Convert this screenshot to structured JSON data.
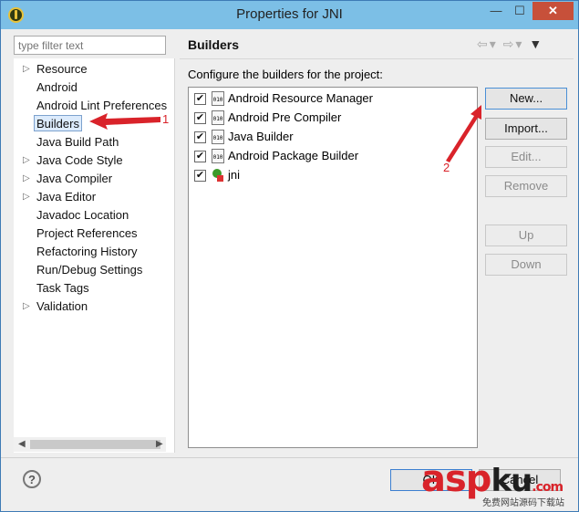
{
  "window": {
    "title": "Properties for JNI",
    "min_label": "—",
    "max_label": "☐",
    "close_label": "✕"
  },
  "filter": {
    "placeholder": "type filter text"
  },
  "tree": {
    "items": [
      {
        "label": "Resource",
        "expandable": true
      },
      {
        "label": "Android",
        "expandable": false
      },
      {
        "label": "Android Lint Preferences",
        "expandable": false
      },
      {
        "label": "Builders",
        "expandable": false,
        "selected": true
      },
      {
        "label": "Java Build Path",
        "expandable": false
      },
      {
        "label": "Java Code Style",
        "expandable": true
      },
      {
        "label": "Java Compiler",
        "expandable": true
      },
      {
        "label": "Java Editor",
        "expandable": true
      },
      {
        "label": "Javadoc Location",
        "expandable": false
      },
      {
        "label": "Project References",
        "expandable": false
      },
      {
        "label": "Refactoring History",
        "expandable": false
      },
      {
        "label": "Run/Debug Settings",
        "expandable": false
      },
      {
        "label": "Task Tags",
        "expandable": false
      },
      {
        "label": "Validation",
        "expandable": true
      }
    ]
  },
  "page": {
    "title": "Builders",
    "config_label": "Configure the builders for the project:"
  },
  "builders": [
    {
      "label": "Android Resource Manager",
      "checked": true,
      "icon": "builder-010-icon"
    },
    {
      "label": "Android Pre Compiler",
      "checked": true,
      "icon": "builder-010-icon"
    },
    {
      "label": "Java Builder",
      "checked": true,
      "icon": "builder-010-icon"
    },
    {
      "label": "Android Package Builder",
      "checked": true,
      "icon": "builder-010-icon"
    },
    {
      "label": "jni",
      "checked": true,
      "icon": "external-tool-icon"
    }
  ],
  "buttons": {
    "new": "New...",
    "import": "Import...",
    "edit": "Edit...",
    "remove": "Remove",
    "up": "Up",
    "down": "Down"
  },
  "footer": {
    "help": "?",
    "ok": "OK",
    "cancel": "Cancel"
  },
  "annotations": {
    "step1": "1",
    "step2": "2",
    "color": "#d9232a"
  },
  "watermark": {
    "brand_a": "asp",
    "brand_b": "ku",
    "suffix": ".com",
    "sub": "免费网站源码下载站"
  }
}
